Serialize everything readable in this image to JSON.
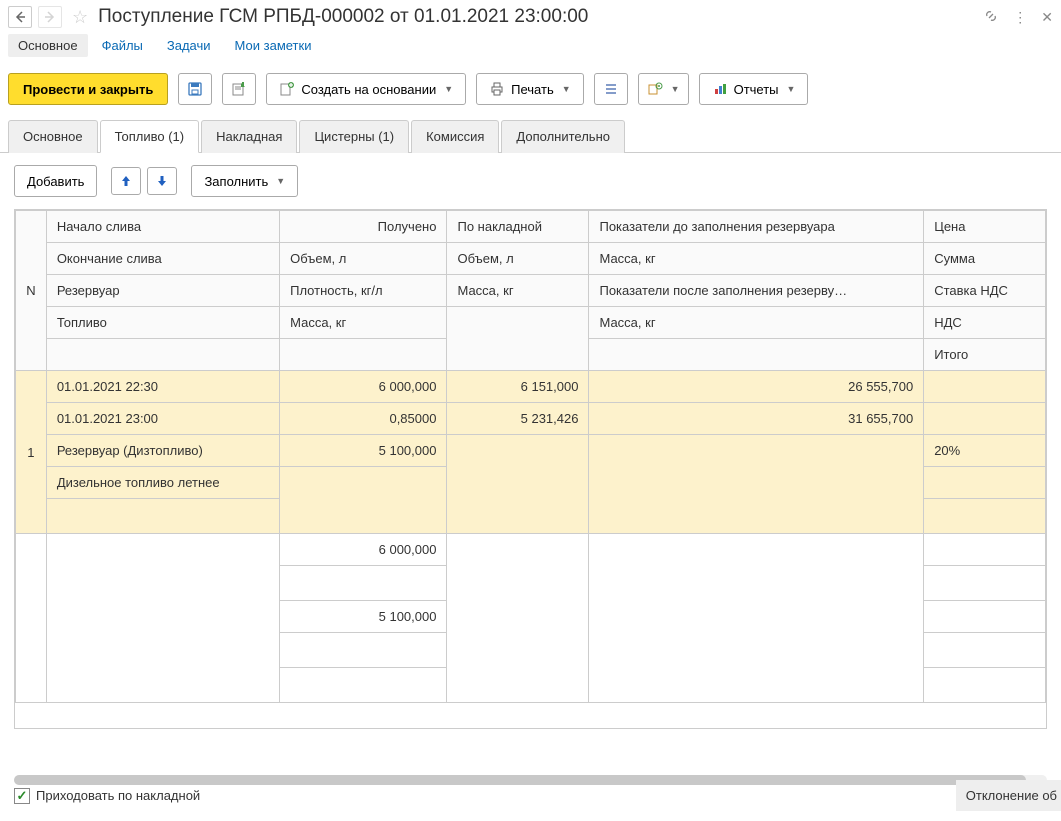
{
  "header": {
    "title": "Поступление ГСМ РПБД-000002 от 01.01.2021 23:00:00"
  },
  "topnav": {
    "main": "Основное",
    "files": "Файлы",
    "tasks": "Задачи",
    "notes": "Мои заметки"
  },
  "toolbar": {
    "post_close": "Провести и закрыть",
    "create_based": "Создать на основании",
    "print": "Печать",
    "reports": "Отчеты"
  },
  "tabs": {
    "main": "Основное",
    "fuel": "Топливо (1)",
    "waybill": "Накладная",
    "tanks": "Цистерны (1)",
    "commission": "Комиссия",
    "extra": "Дополнительно"
  },
  "subtoolbar": {
    "add": "Добавить",
    "fill": "Заполнить"
  },
  "table": {
    "headers": {
      "n": "N",
      "start": "Начало слива",
      "end": "Окончание слива",
      "tank": "Резервуар",
      "fuel": "Топливо",
      "received": "Получено",
      "volume": "Объем, л",
      "density": "Плотность, кг/л",
      "mass": "Масса, кг",
      "invoice": "По накладной",
      "inv_volume": "Объем, л",
      "inv_mass": "Масса, кг",
      "before": "Показатели до заполнения резервуара",
      "before_mass": "Масса, кг",
      "after": "Показатели после заполнения резерву…",
      "after_mass": "Масса, кг",
      "price": "Цена",
      "sum": "Сумма",
      "vat_rate": "Ставка НДС",
      "vat": "НДС",
      "total": "Итого"
    },
    "row1": {
      "n": "1",
      "start": "01.01.2021 22:30",
      "end": "01.01.2021 23:00",
      "tank": "Резервуар (Дизтопливо)",
      "fuel": "Дизельное топливо летнее",
      "recv_vol": "6 000,000",
      "recv_dens": "0,85000",
      "recv_mass": "5 100,000",
      "inv_vol": "6 151,000",
      "inv_mass": "5 231,426",
      "before_mass": "26 555,700",
      "after_mass": "31 655,700",
      "vat_rate": "20%"
    },
    "totals": {
      "vol": "6 000,000",
      "mass": "5 100,000"
    }
  },
  "footer": {
    "checkbox": "Приходовать по накладной",
    "deviation": "Отклонение об"
  }
}
